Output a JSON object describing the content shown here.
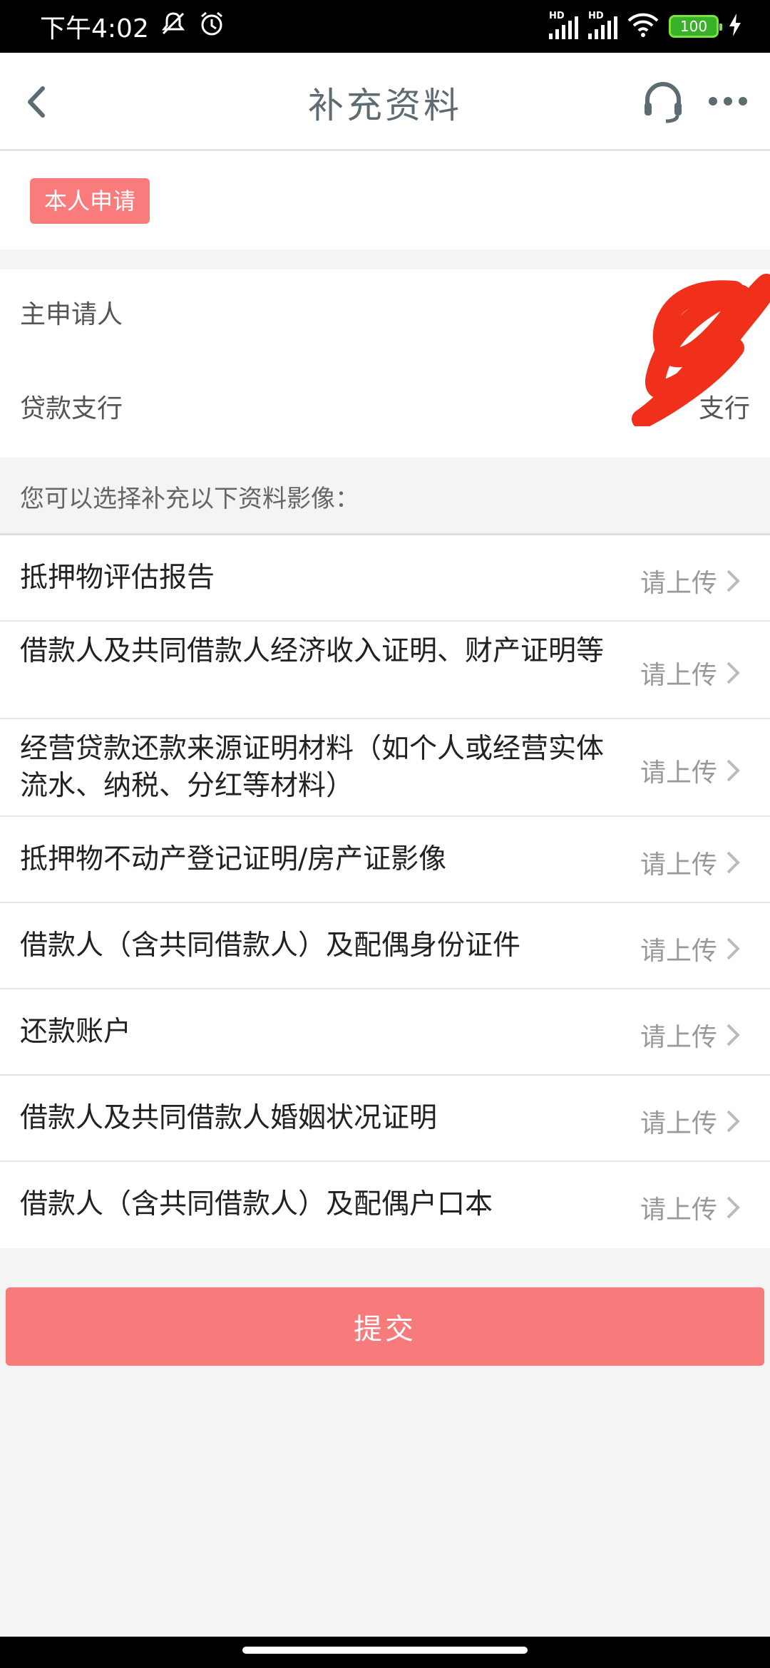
{
  "status_bar": {
    "time": "下午4:02",
    "signal1_label": "HD",
    "signal2_label": "HD",
    "battery": "100"
  },
  "nav": {
    "title": "补充资料",
    "icons": [
      "chevron-left-icon",
      "headset-icon",
      "more-icon"
    ]
  },
  "tag": {
    "label": "本人申请"
  },
  "info": {
    "applicant_label": "主申请人",
    "branch_label": "贷款支行",
    "branch_value": "支行"
  },
  "hint": "您可以选择补充以下资料影像：",
  "documents": [
    {
      "label": "抵押物评估报告",
      "action": "请上传"
    },
    {
      "label": "借款人及共同借款人经济收入证明、财产证明等",
      "action": "请上传"
    },
    {
      "label": "经营贷款还款来源证明材料（如个人或经营实体流水、纳税、分红等材料）",
      "action": "请上传"
    },
    {
      "label": "抵押物不动产登记证明/房产证影像",
      "action": "请上传"
    },
    {
      "label": "借款人（含共同借款人）及配偶身份证件",
      "action": "请上传"
    },
    {
      "label": "还款账户",
      "action": "请上传"
    },
    {
      "label": "借款人及共同借款人婚姻状况证明",
      "action": "请上传"
    },
    {
      "label": "借款人（含共同借款人）及配偶户口本",
      "action": "请上传"
    }
  ],
  "submit_label": "提交",
  "colors": {
    "accent": "#f87b7c",
    "title": "#5d6b72"
  }
}
